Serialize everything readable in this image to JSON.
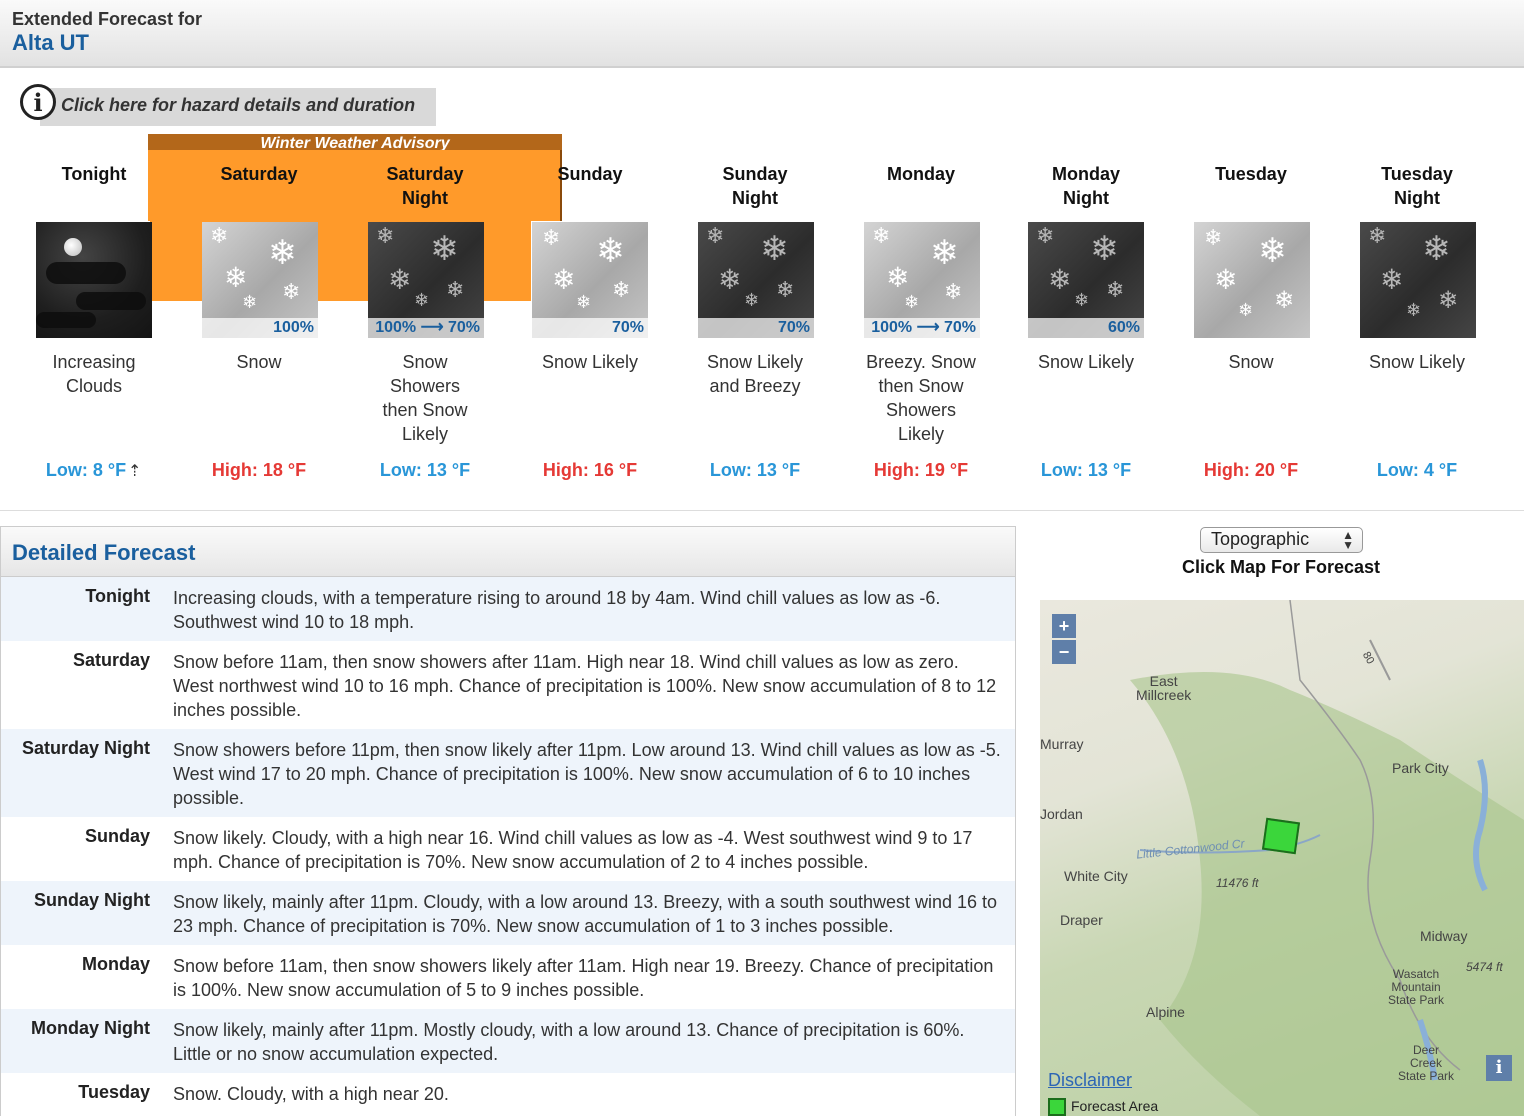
{
  "header": {
    "label": "Extended Forecast for",
    "location": "Alta UT"
  },
  "hazard": {
    "link_text": "Click here for hazard details and duration",
    "icon": "info-icon",
    "advisory": "Winter Weather Advisory"
  },
  "periods": [
    {
      "name": "Tonight",
      "desc": "Increasing Clouds",
      "temp": "Low: 8 °F",
      "pop": "",
      "icon": "night-clouds-icon"
    },
    {
      "name": "Saturday",
      "desc": "Snow",
      "temp": "High: 18 °F",
      "pop": "100%",
      "icon": "snow-icon"
    },
    {
      "name": "Saturday Night",
      "desc": "Snow Showers then Snow Likely",
      "temp": "Low: 13 °F",
      "pop": "100% ⟶ 70%",
      "icon": "snow-night-icon"
    },
    {
      "name": "Sunday",
      "desc": "Snow Likely",
      "temp": "High: 16 °F",
      "pop": "70%",
      "icon": "snow-icon"
    },
    {
      "name": "Sunday Night",
      "desc": "Snow Likely and Breezy",
      "temp": "Low: 13 °F",
      "pop": "70%",
      "icon": "snow-night-icon"
    },
    {
      "name": "Monday",
      "desc": "Breezy. Snow then Snow Showers Likely",
      "temp": "High: 19 °F",
      "pop": "100% ⟶ 70%",
      "icon": "snow-icon"
    },
    {
      "name": "Monday Night",
      "desc": "Snow Likely",
      "temp": "Low: 13 °F",
      "pop": "60%",
      "icon": "snow-night-icon"
    },
    {
      "name": "Tuesday",
      "desc": "Snow",
      "temp": "High: 20 °F",
      "pop": "",
      "icon": "snow-icon"
    },
    {
      "name": "Tuesday Night",
      "desc": "Snow Likely",
      "temp": "Low: 4 °F",
      "pop": "",
      "icon": "snow-night-icon"
    }
  ],
  "detailed": {
    "title": "Detailed Forecast",
    "rows": [
      {
        "label": "Tonight",
        "text": "Increasing clouds, with a temperature rising to around 18 by 4am. Wind chill values as low as -6. Southwest wind 10 to 18 mph."
      },
      {
        "label": "Saturday",
        "text": "Snow before 11am, then snow showers after 11am. High near 18. Wind chill values as low as zero. West northwest wind 10 to 16 mph. Chance of precipitation is 100%. New snow accumulation of 8 to 12 inches possible."
      },
      {
        "label": "Saturday Night",
        "text": "Snow showers before 11pm, then snow likely after 11pm. Low around 13. Wind chill values as low as -5. West wind 17 to 20 mph. Chance of precipitation is 100%. New snow accumulation of 6 to 10 inches possible."
      },
      {
        "label": "Sunday",
        "text": "Snow likely. Cloudy, with a high near 16. Wind chill values as low as -4. West southwest wind 9 to 17 mph. Chance of precipitation is 70%. New snow accumulation of 2 to 4 inches possible."
      },
      {
        "label": "Sunday Night",
        "text": "Snow likely, mainly after 11pm. Cloudy, with a low around 13. Breezy, with a south southwest wind 16 to 23 mph. Chance of precipitation is 70%. New snow accumulation of 1 to 3 inches possible."
      },
      {
        "label": "Monday",
        "text": "Snow before 11am, then snow showers likely after 11am. High near 19. Breezy. Chance of precipitation is 100%. New snow accumulation of 5 to 9 inches possible."
      },
      {
        "label": "Monday Night",
        "text": "Snow likely, mainly after 11pm. Mostly cloudy, with a low around 13. Chance of precipitation is 60%. Little or no snow accumulation expected."
      },
      {
        "label": "Tuesday",
        "text": "Snow. Cloudy, with a high near 20."
      }
    ]
  },
  "map": {
    "select_value": "Topographic",
    "caption": "Click Map For Forecast",
    "zoom_in": "+",
    "zoom_out": "−",
    "labels": [
      "East Millcreek",
      "Murray",
      "Jordan",
      "White City",
      "Draper",
      "Park City",
      "Midway",
      "Wasatch Mountain State Park",
      "Alpine",
      "Deer Creek State Park",
      "11476 ft",
      "5474 ft",
      "Little Cottonwood Cr",
      "80"
    ],
    "disclaimer": "Disclaimer",
    "legend": "Forecast Area",
    "info": "i"
  },
  "colors": {
    "link_blue": "#1a5f9e",
    "low_temp": "#2996d8",
    "high_temp": "#e53935",
    "advisory": "#ff9a2a"
  }
}
